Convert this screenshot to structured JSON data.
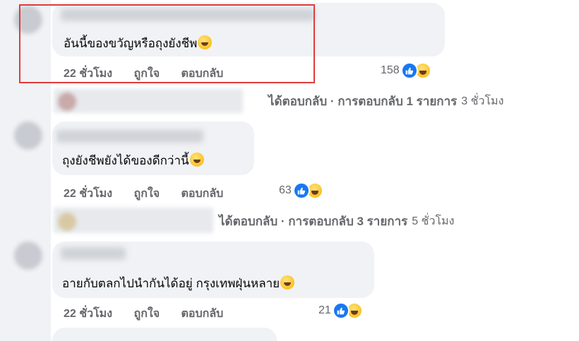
{
  "comments": [
    {
      "text": "อันนี้ของขวัญหรือถุงยังชีพ",
      "time": "22 ชั่วโมง",
      "like": "ถูกใจ",
      "reply": "ตอบกลับ",
      "reaction_count": "158",
      "replies_summary": "ได้ตอบกลับ · การตอบกลับ 1 รายการ",
      "replies_time": "3 ชั่วโมง"
    },
    {
      "text": "ถุงยังชีพยังได้ของดีกว่านี้",
      "time": "22 ชั่วโมง",
      "like": "ถูกใจ",
      "reply": "ตอบกลับ",
      "reaction_count": "63",
      "replies_summary": "ได้ตอบกลับ · การตอบกลับ 3 รายการ",
      "replies_time": "5 ชั่วโมง"
    },
    {
      "text": "อายกับตลกไปนำกันได้อยู่ กรุงเทพฝุ่นหลาย",
      "time": "22 ชั่วโมง",
      "like": "ถูกใจ",
      "reply": "ตอบกลับ",
      "reaction_count": "21"
    }
  ],
  "colors": {
    "like_blue": "#1877f2",
    "highlight_red": "#e03c3c",
    "bubble_gray": "#f0f2f5"
  }
}
